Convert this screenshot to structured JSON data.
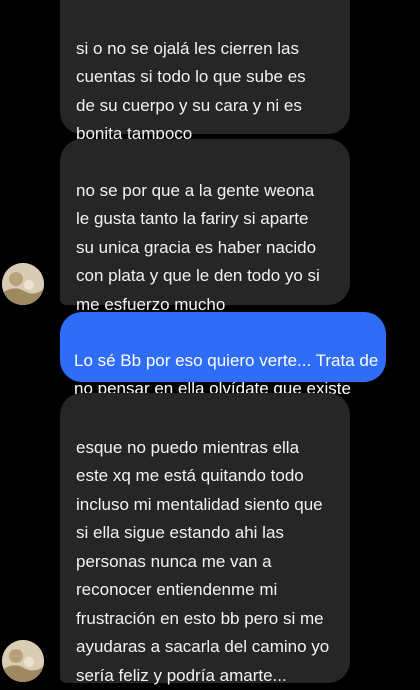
{
  "messages": [
    {
      "direction": "received",
      "text": "si o no se ojalá les cierren las\ncuentas si todo lo que sube es\nde su cuerpo y su cara y ni es\nbonita tampoco"
    },
    {
      "direction": "received",
      "text": "no se por que a la gente weona\nle gusta tanto la fariry si aparte\nsu unica gracia es haber nacido\ncon plata y que le den todo yo si\nme esfuerzo mucho"
    },
    {
      "direction": "sent",
      "text": "Lo sé Bb por eso quiero verte... Trata de\nno pensar en ella olvídate que existe"
    },
    {
      "direction": "received",
      "text": "esque no puedo mientras ella\neste xq me está quitando todo\nincluso mi mentalidad siento que\nsi ella sigue estando ahi las\npersonas nunca me van a\nreconocer entiendenme mi\nfrustración en esto bb pero si me\nayudaras a sacarla del camino yo\nsería feliz y podría amarte..."
    }
  ],
  "colors": {
    "background": "#000000",
    "received_bubble": "#262626",
    "sent_bubble": "#2f6df6",
    "text": "#f2f2f2"
  },
  "avatar_icon": "profile-photo"
}
